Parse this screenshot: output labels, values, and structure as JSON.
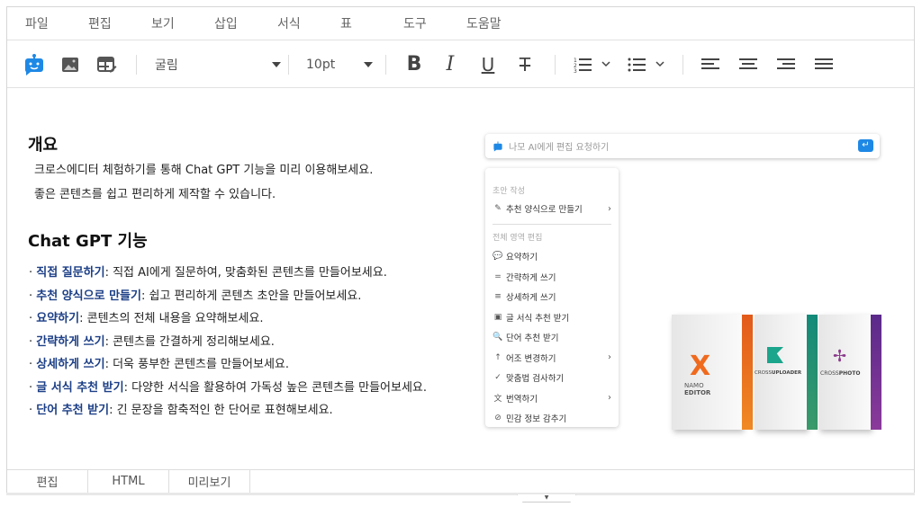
{
  "menu": [
    "파일",
    "편집",
    "보기",
    "삽입",
    "서식",
    "표",
    "도구",
    "도움말"
  ],
  "toolbar": {
    "font": "굴림",
    "size": "10pt"
  },
  "colors": {
    "accent": "#1e88e5",
    "term": "#1c3f86"
  },
  "doc": {
    "h1": "개요",
    "p1": "크로스에디터 체험하기를 통해 Chat GPT 기능을 미리 이용해보세요.",
    "p2": "좋은 콘텐츠를 쉽고 편리하게 제작할 수 있습니다.",
    "h2": "Chat GPT 기능",
    "items": [
      {
        "term": "직접 질문하기",
        "desc": ": 직접 AI에게 질문하여, 맞춤화된 콘텐츠를 만들어보세요."
      },
      {
        "term": "추천 양식으로 만들기",
        "desc": ": 쉽고 편리하게 콘텐츠 초안을 만들어보세요."
      },
      {
        "term": "요약하기",
        "desc": ": 콘텐츠의 전체 내용을 요약해보세요."
      },
      {
        "term": "간략하게 쓰기",
        "desc": ": 콘텐츠를 간결하게 정리해보세요."
      },
      {
        "term": "상세하게 쓰기",
        "desc": ": 더욱 풍부한 콘텐츠를 만들어보세요."
      },
      {
        "term": "글 서식 추천 받기",
        "desc": ": 다양한 서식을 활용하여 가독성 높은 콘텐츠를 만들어보세요."
      },
      {
        "term": "단어 추천 받기",
        "desc": ": 긴 문장을 함축적인 한 단어로 표현해보세요."
      }
    ]
  },
  "ai": {
    "placeholder": "나모 AI에게 편집 요청하기",
    "section1": "초안 작성",
    "draft": "추천 양식으로 만들기",
    "section2": "전체 영역 편집",
    "items": [
      "요약하기",
      "간략하게 쓰기",
      "상세하게 쓰기",
      "글 서식 추천 받기",
      "단어 추천 받기",
      "어조 변경하기",
      "맞춤법 검사하기",
      "번역하기",
      "민감 정보 감추기"
    ]
  },
  "product_image": {
    "boxes": [
      "NAMO EDITOR",
      "CROSSUPLOADER",
      "CROSSPHOTO"
    ]
  },
  "tabs": [
    "편집",
    "HTML",
    "미리보기"
  ]
}
